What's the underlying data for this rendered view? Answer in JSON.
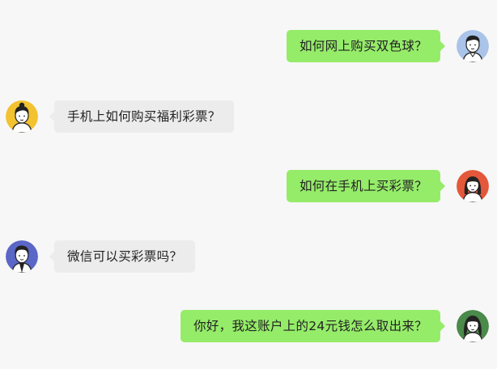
{
  "messages": [
    {
      "side": "right",
      "text": "如何网上购买双色球？",
      "avatar": "avatar-man-blue-bg",
      "avatar_bg": "#a9c4e8"
    },
    {
      "side": "left",
      "text": "手机上如何购买福利彩票？",
      "avatar": "avatar-woman-yellow-bg",
      "avatar_bg": "#f2c230"
    },
    {
      "side": "right",
      "text": "如何在手机上买彩票？",
      "avatar": "avatar-woman-red-bg",
      "avatar_bg": "#e4573a"
    },
    {
      "side": "left",
      "text": "微信可以买彩票吗？",
      "avatar": "avatar-man-purple-bg",
      "avatar_bg": "#5b67c6"
    },
    {
      "side": "right",
      "text": "你好，我这账户上的24元钱怎么取出来？",
      "avatar": "avatar-woman-green-bg",
      "avatar_bg": "#4a8a4a"
    }
  ],
  "colors": {
    "background": "#f7f7f7",
    "sent_bubble": "#95ec69",
    "received_bubble": "#ececec",
    "text": "#222222"
  }
}
